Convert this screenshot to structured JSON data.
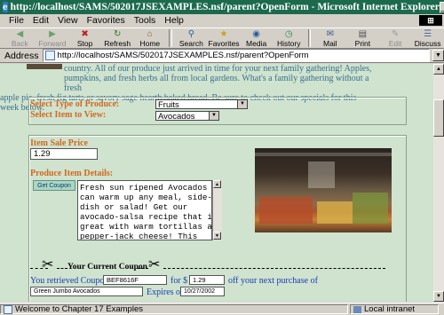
{
  "window": {
    "title": "http://localhost/SAMS/502017JSEXAMPLES.nsf/parent?OpenForm - Microsoft Internet Explorer"
  },
  "menu": [
    "File",
    "Edit",
    "View",
    "Favorites",
    "Tools",
    "Help"
  ],
  "toolbar": [
    {
      "label": "Back",
      "icon": "back-arrow-icon",
      "enabled": false
    },
    {
      "label": "Forward",
      "icon": "forward-arrow-icon",
      "enabled": false
    },
    {
      "label": "Stop",
      "icon": "stop-icon",
      "enabled": true
    },
    {
      "label": "Refresh",
      "icon": "refresh-icon",
      "enabled": true
    },
    {
      "label": "Home",
      "icon": "home-icon",
      "enabled": true
    },
    {
      "label": "Search",
      "icon": "search-icon",
      "enabled": true
    },
    {
      "label": "Favorites",
      "icon": "favorites-icon",
      "enabled": true
    },
    {
      "label": "Media",
      "icon": "media-icon",
      "enabled": true
    },
    {
      "label": "History",
      "icon": "history-icon",
      "enabled": true
    },
    {
      "label": "Mail",
      "icon": "mail-icon",
      "enabled": true
    },
    {
      "label": "Print",
      "icon": "print-icon",
      "enabled": true
    },
    {
      "label": "Edit",
      "icon": "edit-icon",
      "enabled": false
    },
    {
      "label": "Discuss",
      "icon": "discuss-icon",
      "enabled": true
    }
  ],
  "address": {
    "label": "Address",
    "url": "http://localhost/SAMS/502017JSEXAMPLES.nsf/parent?OpenForm"
  },
  "page": {
    "intro_line1": "country. All of our produce just arrived in time for your next family gathering! Apples,",
    "intro_line2": "pumpkins, and fresh herbs all from local gardens. What's a family gathering without a fresh",
    "intro_line3": "apple pie, fresh fig tarts or savory sage hearth baked bread. Be sure to check out our specials for this week below.",
    "type_label": "Select Type of Produce:",
    "type_value": "Fruits",
    "item_label": "Select Item to View:",
    "item_value": "Avocados",
    "price_label": "Item Sale Price",
    "price_value": "1.29",
    "details_label": "Produce Item Details:",
    "get_coupon": "Get Coupon",
    "details_text": "Fresh sun ripened Avocados\ncan warm up any meal, side-\ndish or salad! Get our\navocado-salsa recipe that is\ngreat with warm tortillas and\npepper-jack cheese! This",
    "coupon_heading": "Your Current Coupon",
    "coupon_retrieved": "You retrieved Coupon #",
    "coupon_number": "BEF8616F",
    "coupon_for": "for $",
    "coupon_amount": "1.29",
    "coupon_off": "off your next purchase of",
    "coupon_item": "Green Jumbo Avocados",
    "coupon_expires": "Expires on:",
    "coupon_date": "10/27/2002"
  },
  "status": {
    "message": "Welcome to Chapter 17 Examples",
    "zone": "Local intranet"
  }
}
